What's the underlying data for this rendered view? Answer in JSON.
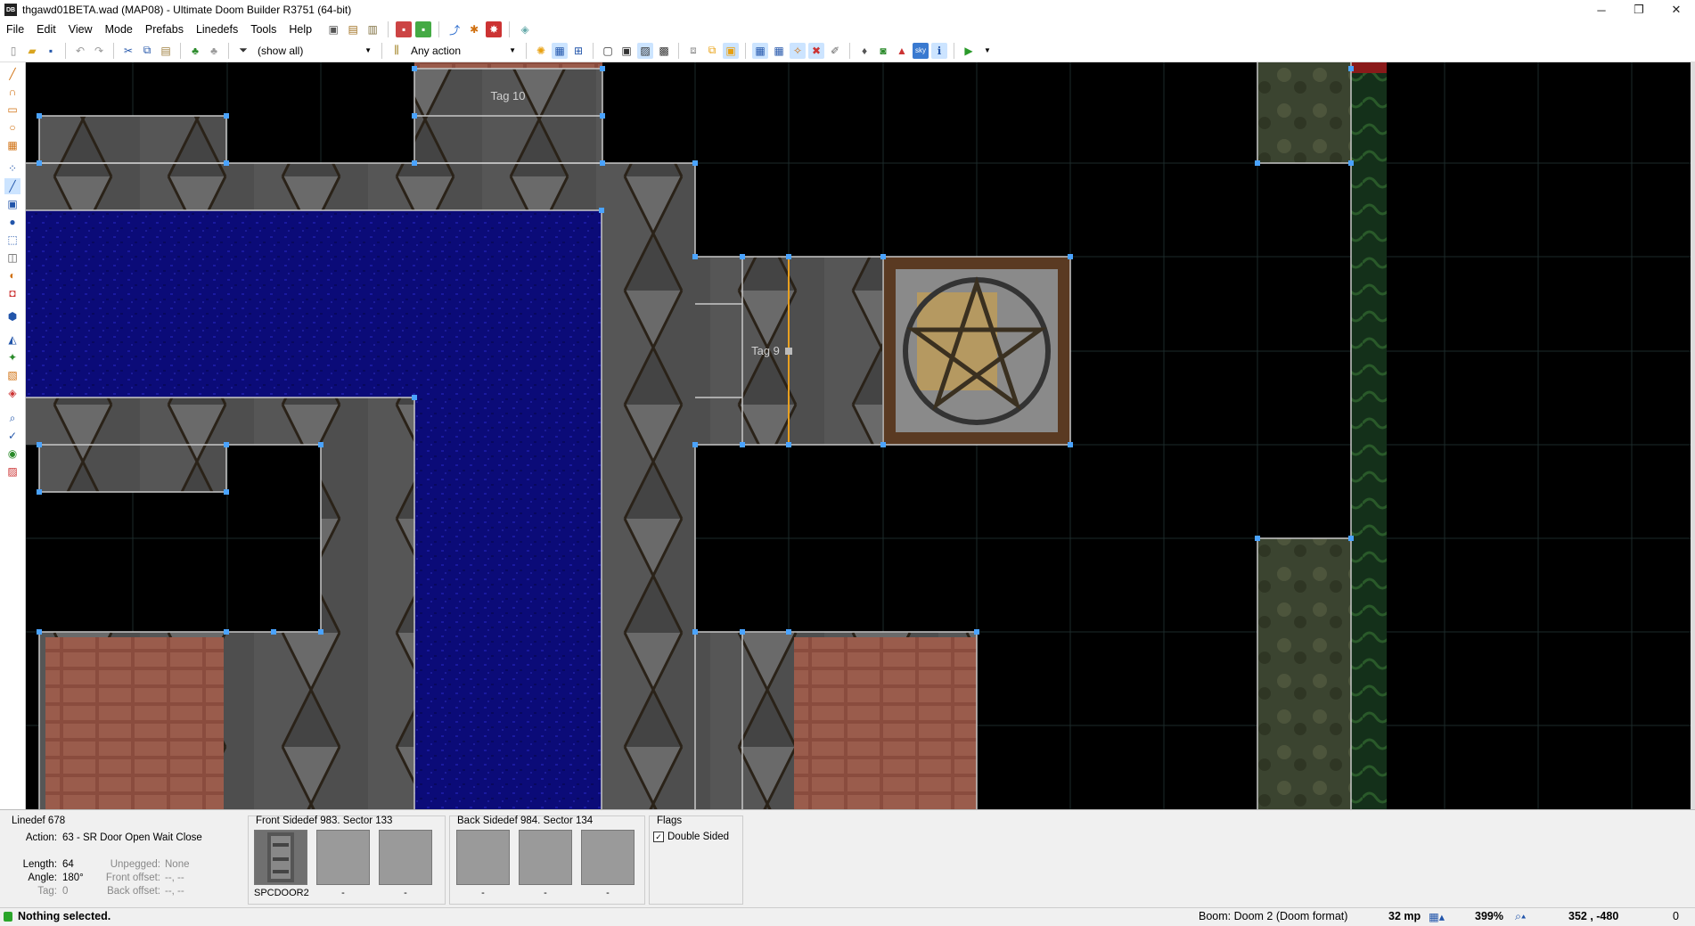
{
  "window": {
    "title": "thgawd01BETA.wad (MAP08) - Ultimate Doom Builder R3751 (64-bit)",
    "app_icon_text": "DB",
    "minimize": "─",
    "restore": "❐",
    "close": "✕"
  },
  "menu": {
    "items": [
      "File",
      "Edit",
      "View",
      "Mode",
      "Prefabs",
      "Linedefs",
      "Tools",
      "Help"
    ]
  },
  "toolbar": {
    "filter_value": "(show all)",
    "action_value": "Any action"
  },
  "map": {
    "labels": [
      {
        "id": "tag10",
        "text": "Tag 10"
      },
      {
        "id": "tag9",
        "text": "Tag 9"
      }
    ]
  },
  "linedef_info": {
    "title": "Linedef 678",
    "action_label": "Action:",
    "action_value": "63 - SR Door Open Wait Close",
    "length_label": "Length:",
    "length_value": "64",
    "angle_label": "Angle:",
    "angle_value": "180°",
    "tag_label": "Tag:",
    "tag_value": "0",
    "unpegged_label": "Unpegged:",
    "unpegged_value": "None",
    "front_offset_label": "Front offset:",
    "front_offset_value": "--, --",
    "back_offset_label": "Back offset:",
    "back_offset_value": "--, --"
  },
  "front_sidedef": {
    "title": "Front Sidedef 983. Sector 133",
    "textures": [
      "SPCDOOR2",
      "-",
      "-"
    ]
  },
  "back_sidedef": {
    "title": "Back Sidedef 984. Sector 134",
    "textures": [
      "-",
      "-",
      "-"
    ]
  },
  "flags": {
    "title": "Flags",
    "double_sided_label": "Double Sided",
    "double_sided_checked": "✓"
  },
  "status": {
    "message": "Nothing selected.",
    "game_config": "Boom: Doom 2 (Doom format)",
    "grid_size": "32 mp",
    "zoom": "399%",
    "coords": "352 , -480",
    "trailing": "0"
  },
  "colors": {
    "water": "#0a0a7a",
    "stone": "#4a4a4a",
    "vertex": "#4aa3ff",
    "selected_line": "#e8a020",
    "brick": "#8a4a3c",
    "grass": "#3a4a2a"
  }
}
